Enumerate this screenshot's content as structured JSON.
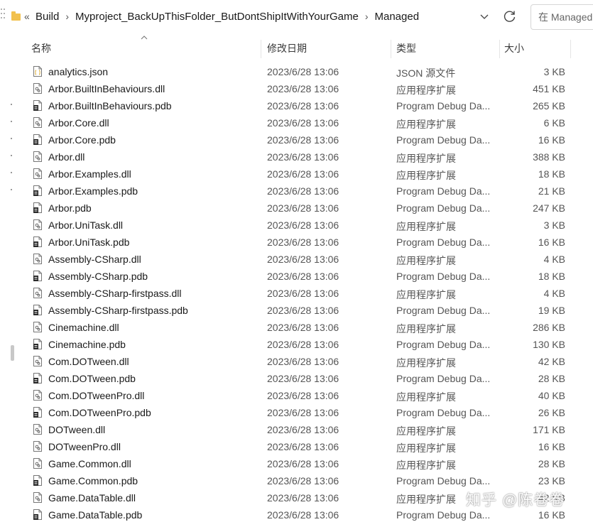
{
  "address": {
    "overflow_label": "«",
    "crumbs": [
      "Build",
      "Myproject_BackUpThisFolder_ButDontShipItWithYourGame",
      "Managed"
    ]
  },
  "search": {
    "placeholder": "在 Managed 中搜索"
  },
  "columns": {
    "name": "名称",
    "date": "修改日期",
    "type": "类型",
    "size": "大小"
  },
  "files": [
    {
      "name": "analytics.json",
      "date": "2023/6/28 13:06",
      "type": "JSON 源文件",
      "size": "3 KB",
      "icon": "json-file-icon"
    },
    {
      "name": "Arbor.BuiltInBehaviours.dll",
      "date": "2023/6/28 13:06",
      "type": "应用程序扩展",
      "size": "451 KB",
      "icon": "dll-file-icon"
    },
    {
      "name": "Arbor.BuiltInBehaviours.pdb",
      "date": "2023/6/28 13:06",
      "type": "Program Debug Da...",
      "size": "265 KB",
      "icon": "pdb-file-icon"
    },
    {
      "name": "Arbor.Core.dll",
      "date": "2023/6/28 13:06",
      "type": "应用程序扩展",
      "size": "6 KB",
      "icon": "dll-file-icon"
    },
    {
      "name": "Arbor.Core.pdb",
      "date": "2023/6/28 13:06",
      "type": "Program Debug Da...",
      "size": "16 KB",
      "icon": "pdb-file-icon"
    },
    {
      "name": "Arbor.dll",
      "date": "2023/6/28 13:06",
      "type": "应用程序扩展",
      "size": "388 KB",
      "icon": "dll-file-icon"
    },
    {
      "name": "Arbor.Examples.dll",
      "date": "2023/6/28 13:06",
      "type": "应用程序扩展",
      "size": "18 KB",
      "icon": "dll-file-icon"
    },
    {
      "name": "Arbor.Examples.pdb",
      "date": "2023/6/28 13:06",
      "type": "Program Debug Da...",
      "size": "21 KB",
      "icon": "pdb-file-icon"
    },
    {
      "name": "Arbor.pdb",
      "date": "2023/6/28 13:06",
      "type": "Program Debug Da...",
      "size": "247 KB",
      "icon": "pdb-file-icon"
    },
    {
      "name": "Arbor.UniTask.dll",
      "date": "2023/6/28 13:06",
      "type": "应用程序扩展",
      "size": "3 KB",
      "icon": "dll-file-icon"
    },
    {
      "name": "Arbor.UniTask.pdb",
      "date": "2023/6/28 13:06",
      "type": "Program Debug Da...",
      "size": "16 KB",
      "icon": "pdb-file-icon"
    },
    {
      "name": "Assembly-CSharp.dll",
      "date": "2023/6/28 13:06",
      "type": "应用程序扩展",
      "size": "4 KB",
      "icon": "dll-file-icon"
    },
    {
      "name": "Assembly-CSharp.pdb",
      "date": "2023/6/28 13:06",
      "type": "Program Debug Da...",
      "size": "18 KB",
      "icon": "pdb-file-icon"
    },
    {
      "name": "Assembly-CSharp-firstpass.dll",
      "date": "2023/6/28 13:06",
      "type": "应用程序扩展",
      "size": "4 KB",
      "icon": "dll-file-icon"
    },
    {
      "name": "Assembly-CSharp-firstpass.pdb",
      "date": "2023/6/28 13:06",
      "type": "Program Debug Da...",
      "size": "19 KB",
      "icon": "pdb-file-icon"
    },
    {
      "name": "Cinemachine.dll",
      "date": "2023/6/28 13:06",
      "type": "应用程序扩展",
      "size": "286 KB",
      "icon": "dll-file-icon"
    },
    {
      "name": "Cinemachine.pdb",
      "date": "2023/6/28 13:06",
      "type": "Program Debug Da...",
      "size": "130 KB",
      "icon": "pdb-file-icon"
    },
    {
      "name": "Com.DOTween.dll",
      "date": "2023/6/28 13:06",
      "type": "应用程序扩展",
      "size": "42 KB",
      "icon": "dll-file-icon"
    },
    {
      "name": "Com.DOTween.pdb",
      "date": "2023/6/28 13:06",
      "type": "Program Debug Da...",
      "size": "28 KB",
      "icon": "pdb-file-icon"
    },
    {
      "name": "Com.DOTweenPro.dll",
      "date": "2023/6/28 13:06",
      "type": "应用程序扩展",
      "size": "40 KB",
      "icon": "dll-file-icon"
    },
    {
      "name": "Com.DOTweenPro.pdb",
      "date": "2023/6/28 13:06",
      "type": "Program Debug Da...",
      "size": "26 KB",
      "icon": "pdb-file-icon"
    },
    {
      "name": "DOTween.dll",
      "date": "2023/6/28 13:06",
      "type": "应用程序扩展",
      "size": "171 KB",
      "icon": "dll-file-icon"
    },
    {
      "name": "DOTweenPro.dll",
      "date": "2023/6/28 13:06",
      "type": "应用程序扩展",
      "size": "16 KB",
      "icon": "dll-file-icon"
    },
    {
      "name": "Game.Common.dll",
      "date": "2023/6/28 13:06",
      "type": "应用程序扩展",
      "size": "28 KB",
      "icon": "dll-file-icon"
    },
    {
      "name": "Game.Common.pdb",
      "date": "2023/6/28 13:06",
      "type": "Program Debug Da...",
      "size": "23 KB",
      "icon": "pdb-file-icon"
    },
    {
      "name": "Game.DataTable.dll",
      "date": "2023/6/28 13:06",
      "type": "应用程序扩展",
      "size": "42 KB",
      "icon": "dll-file-icon"
    },
    {
      "name": "Game.DataTable.pdb",
      "date": "2023/6/28 13:06",
      "type": "Program Debug Da...",
      "size": "16 KB",
      "icon": "pdb-file-icon"
    }
  ],
  "watermark": "知乎 @陈卷卷",
  "colors": {
    "folder": "#f2c14e",
    "text": "#1a1a1a",
    "muted": "#555555",
    "divider": "#e5e5e5"
  }
}
